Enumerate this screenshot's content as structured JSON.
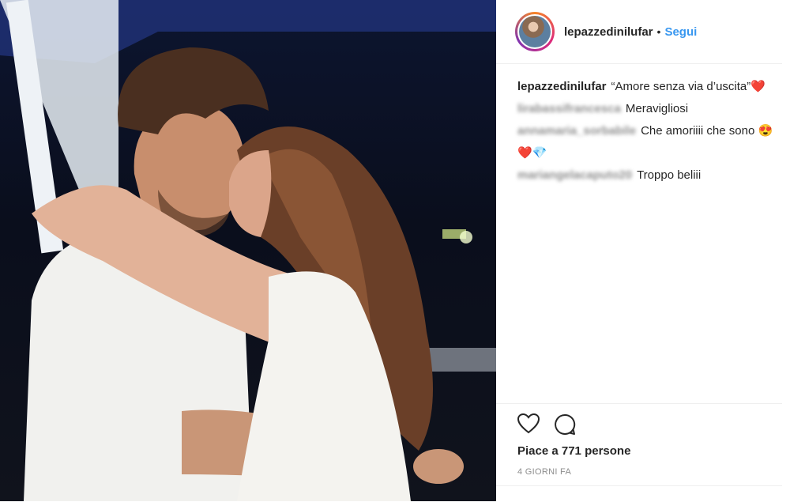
{
  "post": {
    "username": "lepazzedinilufar",
    "separator": "•",
    "follow_label": "Segui",
    "caption": "“Amore senza via d’uscita”",
    "caption_emoji": "❤️",
    "photo_description_icon": "photo"
  },
  "comments": [
    {
      "user": "lirabassifrancesca",
      "text": "Meravigliosi",
      "emoji": ""
    },
    {
      "user": "annamaria_sorbabile",
      "text": "Che amoriiii che sono",
      "emoji": "😍 ❤️💎"
    },
    {
      "user": "mariangelacaputo20",
      "text": "Troppo beliii",
      "emoji": ""
    }
  ],
  "actions": {
    "like_icon": "heart-icon",
    "comment_icon": "comment-icon"
  },
  "likes_text": "Piace a 771 persone",
  "time_text": "4 GIORNI FA",
  "colors": {
    "link": "#3897f0",
    "text": "#262626",
    "muted": "#8e8e8e"
  }
}
